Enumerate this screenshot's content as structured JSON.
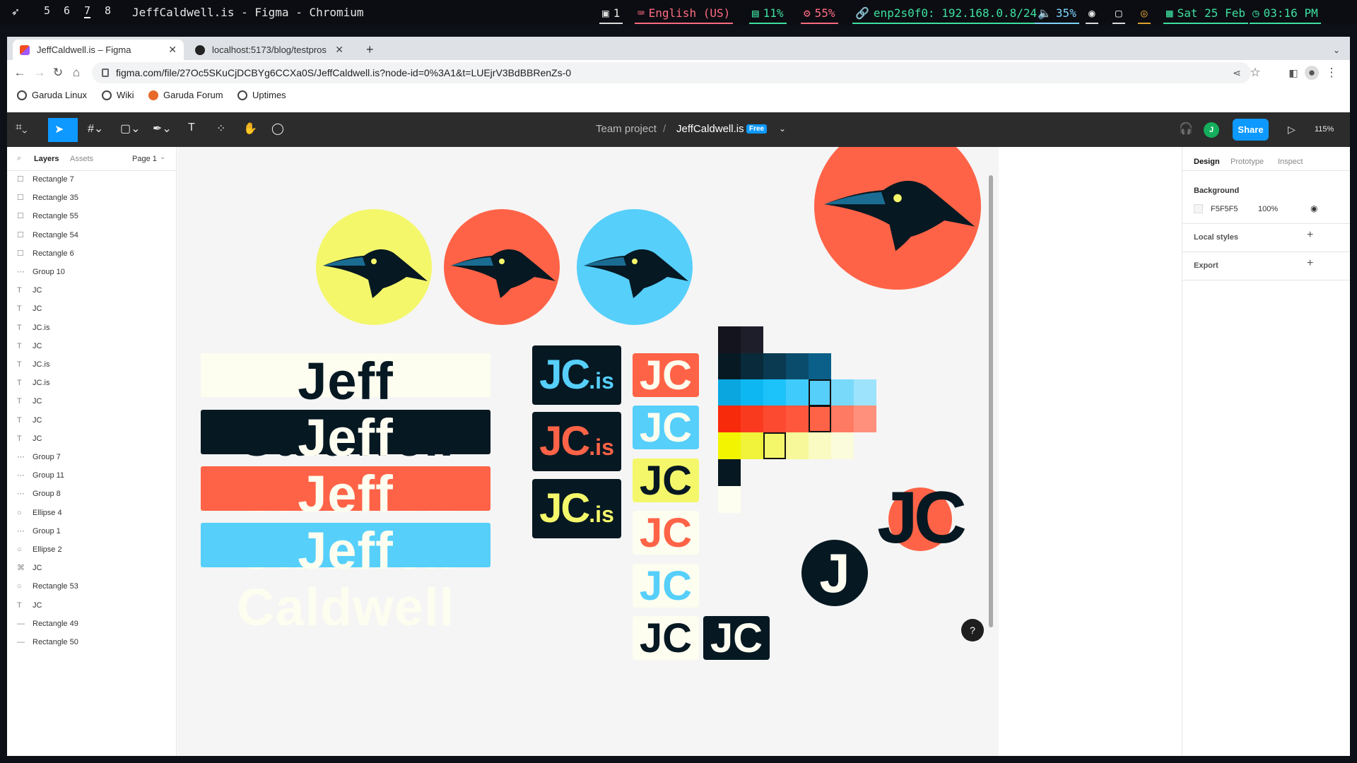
{
  "system_bar": {
    "workspaces": [
      "5",
      "6",
      "7",
      "8"
    ],
    "active_workspace": "7",
    "window_title": "JeffCaldwell.is - Figma - Chromium",
    "tray_count": "1",
    "keyboard": "English (US)",
    "cpu": "11%",
    "memory": "55%",
    "network": "enp2s0f0: 192.168.0.8/24",
    "volume": "35%",
    "date": "Sat 25 Feb",
    "time": "03:16 PM"
  },
  "browser": {
    "tabs": [
      {
        "label": "JeffCaldwell.is – Figma",
        "active": true
      },
      {
        "label": "localhost:5173/blog/testpros",
        "active": false
      }
    ],
    "new_tab": "+",
    "url": "figma.com/file/27Oc5SKuCjDCBYg6CCXa0S/JeffCaldwell.is?node-id=0%3A1&t=LUEjrV3BdBBRenZs-0",
    "bookmarks": [
      "Garuda Linux",
      "Wiki",
      "Garuda Forum",
      "Uptimes"
    ]
  },
  "figma_toolbar": {
    "project": "Team project",
    "separator": "/",
    "file_name": "JeffCaldwell.is",
    "plan_badge": "Free",
    "avatar_initial": "J",
    "share_label": "Share",
    "zoom": "115%"
  },
  "left_panel": {
    "tabs": [
      "Layers",
      "Assets"
    ],
    "page": "Page 1",
    "layers": [
      {
        "name": "Rectangle 7",
        "icon": "rect"
      },
      {
        "name": "Rectangle 35",
        "icon": "rect"
      },
      {
        "name": "Rectangle 55",
        "icon": "rect"
      },
      {
        "name": "Rectangle 54",
        "icon": "rect"
      },
      {
        "name": "Rectangle 6",
        "icon": "rect"
      },
      {
        "name": "Group 10",
        "icon": "group"
      },
      {
        "name": "JC",
        "icon": "text"
      },
      {
        "name": "JC",
        "icon": "text"
      },
      {
        "name": "JC.is",
        "icon": "text"
      },
      {
        "name": "JC",
        "icon": "text"
      },
      {
        "name": "JC.is",
        "icon": "text"
      },
      {
        "name": "JC.is",
        "icon": "text"
      },
      {
        "name": "JC",
        "icon": "text"
      },
      {
        "name": "JC",
        "icon": "text"
      },
      {
        "name": "JC",
        "icon": "text"
      },
      {
        "name": "Group 7",
        "icon": "group"
      },
      {
        "name": "Group 11",
        "icon": "group"
      },
      {
        "name": "Group 8",
        "icon": "group"
      },
      {
        "name": "Ellipse 4",
        "icon": "ellipse"
      },
      {
        "name": "Group 1",
        "icon": "group"
      },
      {
        "name": "Ellipse 2",
        "icon": "ellipse"
      },
      {
        "name": "JC",
        "icon": "vector"
      },
      {
        "name": "Rectangle 53",
        "icon": "ellipse"
      },
      {
        "name": "JC",
        "icon": "text"
      },
      {
        "name": "Rectangle 49",
        "icon": "line"
      },
      {
        "name": "Rectangle 50",
        "icon": "line"
      }
    ]
  },
  "canvas": {
    "wordmark_text": "Jeff Caldwell",
    "logo_jcis": "JC",
    "logo_is": ".is",
    "logo_jc": "JC",
    "logo_j": "J",
    "colors": {
      "yellow": "#f4f76a",
      "coral": "#ff6347",
      "sky": "#56cffa",
      "navy": "#061822",
      "cream": "#fdfdf0"
    }
  },
  "right_panel": {
    "tabs": [
      "Design",
      "Prototype",
      "Inspect"
    ],
    "background_label": "Background",
    "background_hex": "F5F5F5",
    "background_opacity": "100%",
    "local_styles": "Local styles",
    "export": "Export",
    "plus": "+"
  },
  "help": "?"
}
